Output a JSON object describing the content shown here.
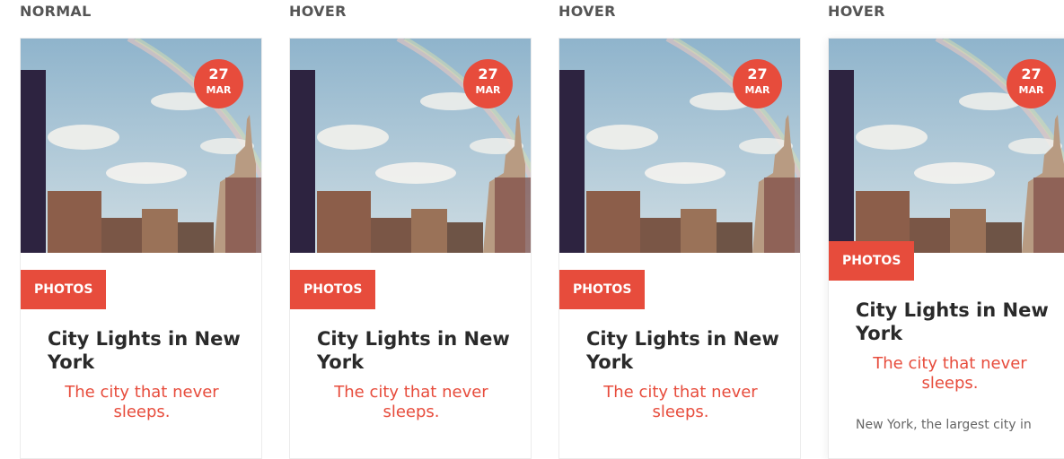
{
  "columns": [
    {
      "state_label": "NORMAL",
      "date_day": "27",
      "date_month": "MAR",
      "category": "PHOTOS",
      "title": "City Lights in New York",
      "subtitle": "The city that never sleeps.",
      "excerpt": ""
    },
    {
      "state_label": "HOVER",
      "date_day": "27",
      "date_month": "MAR",
      "category": "PHOTOS",
      "title": "City Lights in New York",
      "subtitle": "The city that never sleeps.",
      "excerpt": ""
    },
    {
      "state_label": "HOVER",
      "date_day": "27",
      "date_month": "MAR",
      "category": "PHOTOS",
      "title": "City Lights in New York",
      "subtitle": "The city that never sleeps.",
      "excerpt": ""
    },
    {
      "state_label": "HOVER",
      "date_day": "27",
      "date_month": "MAR",
      "category": "PHOTOS",
      "title": "City Lights in New York",
      "subtitle": "The city that never sleeps.",
      "excerpt": "New York, the largest city in"
    }
  ],
  "colors": {
    "accent": "#e74c3c",
    "label": "#555555",
    "title": "#2a2a2a"
  }
}
